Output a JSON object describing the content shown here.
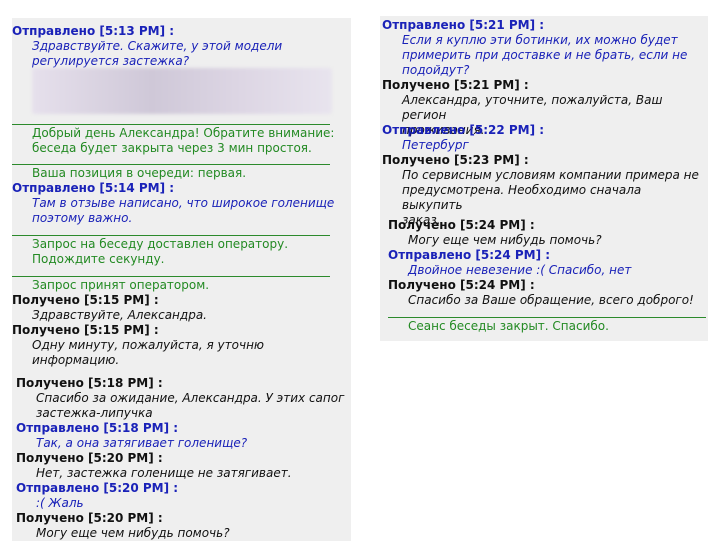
{
  "left_panel": {
    "m1": {
      "header": "Отправлено [5:13 PM] :",
      "lines": [
        "Здравствуйте. Скажите, у этой модели",
        "регулируется застежка?"
      ]
    },
    "s1": {
      "lines": [
        "Добрый день Александра! Обратите внимание:",
        "беседа будет закрыта через 3 мин простоя."
      ]
    },
    "s2": {
      "lines": [
        "Ваша позиция в очереди: первая."
      ]
    },
    "m2": {
      "header": "Отправлено [5:14 PM] :",
      "lines": [
        "Там в отзыве написано, что широкое голенище",
        "поэтому важно."
      ]
    },
    "s3": {
      "lines": [
        "Запрос на беседу доставлен оператору.",
        "Подождите секунду."
      ]
    },
    "s4": {
      "lines": [
        "Запрос принят оператором."
      ]
    },
    "m3": {
      "header": "Получено [5:15 PM] :",
      "lines": [
        "Здравствуйте, Александра."
      ]
    },
    "m4": {
      "header": "Получено [5:15 PM] :",
      "lines": [
        "Одну минуту, пожалуйста, я уточню",
        "информацию."
      ]
    },
    "m5": {
      "header": "Получено [5:18 PM] :",
      "lines": [
        "Спасибо за ожидание, Александра. У этих сапог",
        "застежка-липучка"
      ]
    },
    "m6": {
      "header": "Отправлено [5:18 PM] :",
      "lines": [
        "Так, а она затягивает голенище?"
      ]
    },
    "m7": {
      "header": "Получено [5:20 PM] :",
      "lines": [
        "Нет, застежка голенище не затягивает."
      ]
    },
    "m8": {
      "header": "Отправлено [5:20 PM] :",
      "lines": [
        ":( Жаль"
      ]
    },
    "m9": {
      "header": "Получено [5:20 PM] :",
      "lines": [
        "Могу еще чем нибудь помочь?"
      ]
    }
  },
  "right_panel": {
    "m1": {
      "header": "Отправлено [5:21 PM] :",
      "lines": [
        "Если я куплю эти ботинки, их можно будет",
        "примерить при доставке и не брать, если не",
        "подойдут?"
      ]
    },
    "m2": {
      "header": "Получено [5:21 PM] :",
      "lines": [
        "Александра, уточните, пожалуйста, Ваш регион",
        "проживания."
      ]
    },
    "m3": {
      "header": "Отправлено [5:22 PM] :",
      "lines": [
        "Петербург"
      ]
    },
    "m4": {
      "header": "Получено [5:23 PM] :",
      "lines": [
        "По сервисным условиям компании примера не",
        "предусмотрена. Необходимо сначала выкупить",
        "заказ."
      ]
    },
    "m5": {
      "header": "Получено [5:24 PM] :",
      "lines": [
        "Могу еще чем нибудь помочь?"
      ]
    },
    "m6": {
      "header": "Отправлено [5:24 PM] :",
      "lines": [
        "Двойное невезение :( Спасибо, нет"
      ]
    },
    "m7": {
      "header": "Получено [5:24 PM] :",
      "lines": [
        "Спасибо за Ваше обращение, всего доброго!"
      ]
    },
    "s1": {
      "lines": [
        "Сеанс беседы закрыт. Спасибо."
      ]
    }
  },
  "colors": {
    "sent": "#1a22b8",
    "received": "#111111",
    "system": "#238a23",
    "panel": "#efefef"
  }
}
